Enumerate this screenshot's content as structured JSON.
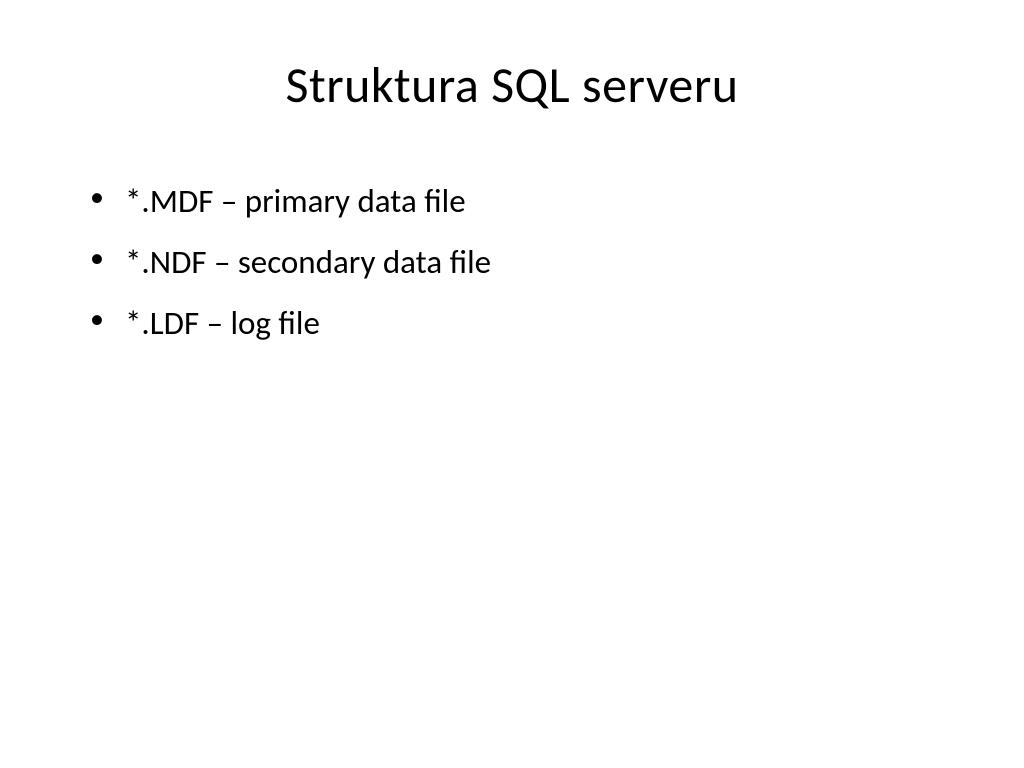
{
  "slide": {
    "title": "Struktura SQL serveru",
    "bullets": [
      "*.MDF – primary data file",
      "*.NDF – secondary data file",
      "*.LDF – log file"
    ]
  }
}
